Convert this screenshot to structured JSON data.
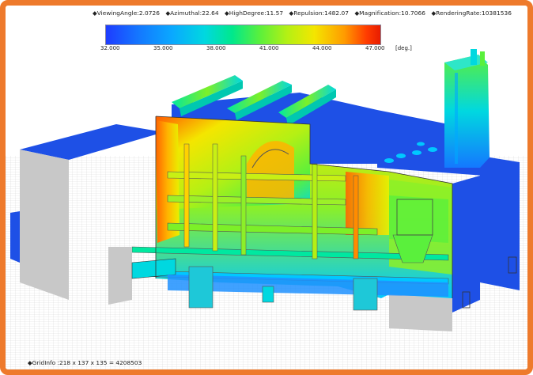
{
  "status": {
    "items": [
      {
        "label": "ViewingAngle",
        "value": "2.0726"
      },
      {
        "label": "Azimuthal",
        "value": "22.64"
      },
      {
        "label": "HighDegree",
        "value": "11.57"
      },
      {
        "label": "Repulsion",
        "value": "1482.07"
      },
      {
        "label": "Magnification",
        "value": "10.7066"
      },
      {
        "label": "RenderingRate",
        "value": "10381536"
      }
    ],
    "bullet": "◆"
  },
  "colorbar": {
    "ticks": [
      "32.000",
      "35.000",
      "38.000",
      "41.000",
      "44.000",
      "47.000"
    ],
    "unit": "[deg.]"
  },
  "grid_info": "◆GridInfo :218 x 137 x 135 = 4208503",
  "colors": {
    "frame": "#ee7a2c",
    "box_top": "#1e50e6",
    "box_side": "#c8c8c8",
    "hot": "#ff3c00",
    "mid": "#c8f014",
    "cool": "#00c8ff"
  }
}
